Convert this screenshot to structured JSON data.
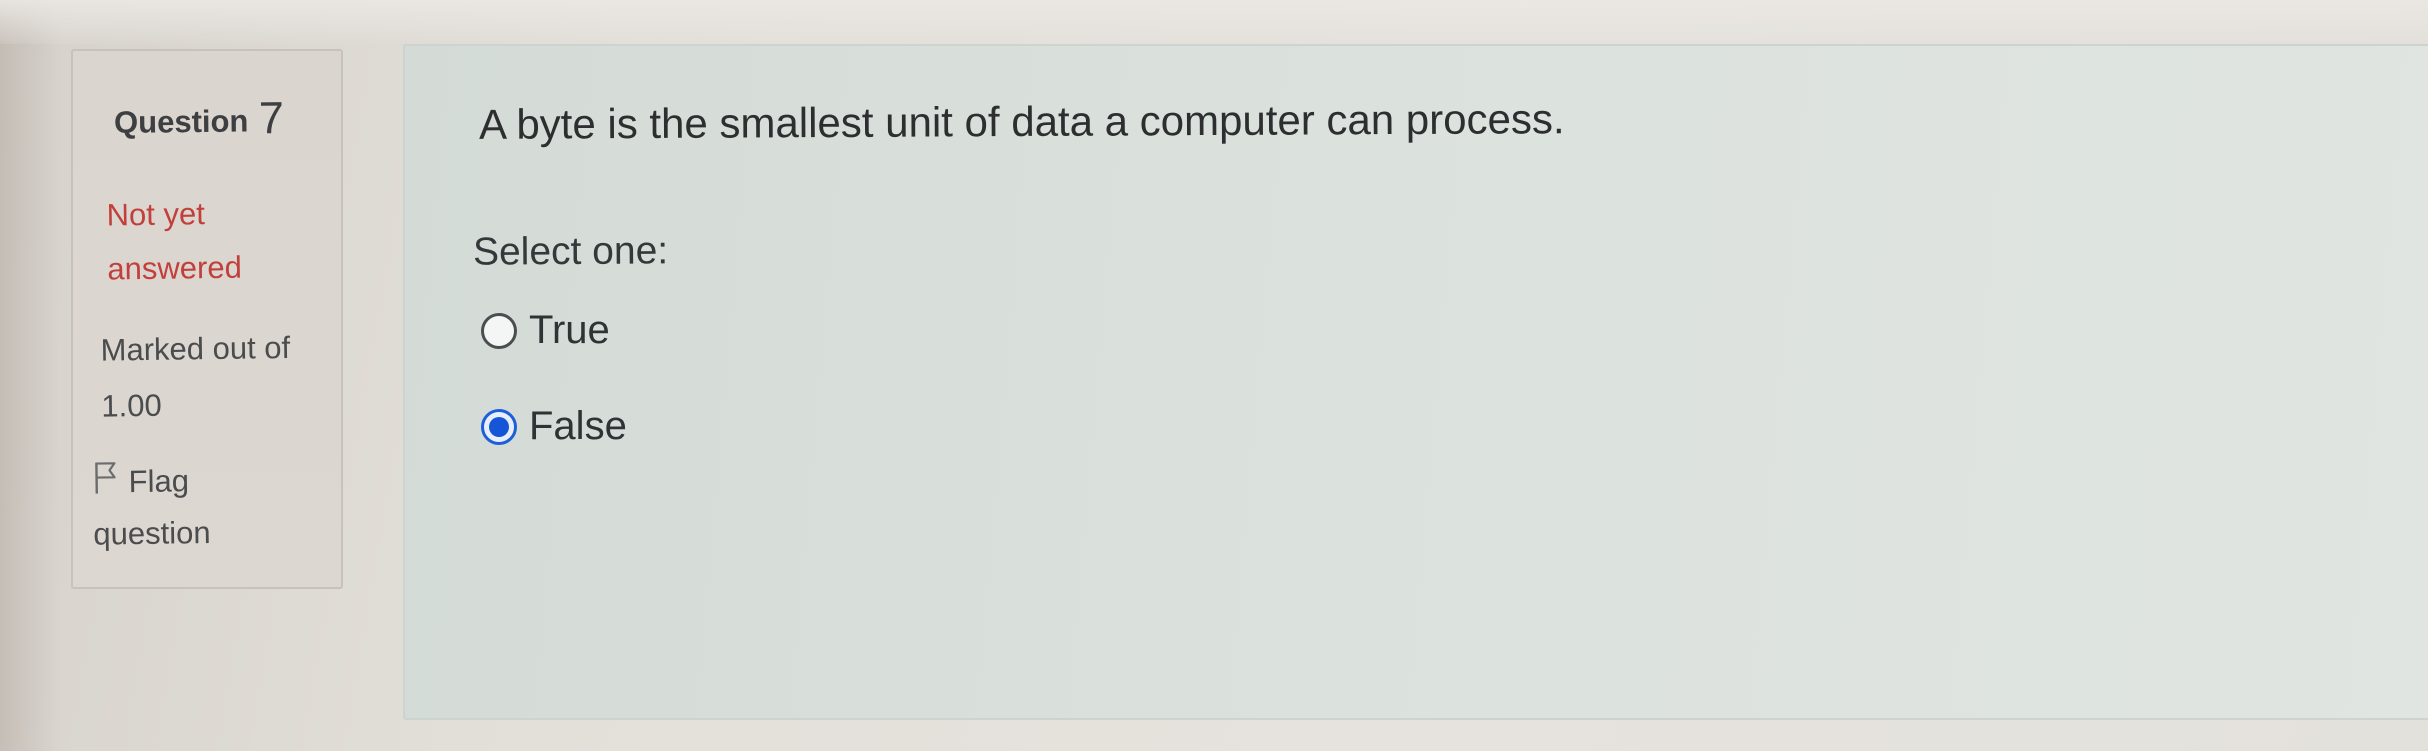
{
  "question_info": {
    "label": "Question",
    "number": "7",
    "state_line1": "Not yet",
    "state_line2": "answered",
    "grade_line1": "Marked out of",
    "grade_line2": "1.00",
    "flag_line1": "Flag",
    "flag_line2": "question",
    "flag_icon": "flag-outline-icon"
  },
  "question": {
    "text": "A byte is the smallest unit of data a computer can process.",
    "prompt": "Select one:",
    "options": [
      {
        "label": "True",
        "checked": false
      },
      {
        "label": "False",
        "checked": true
      }
    ]
  },
  "colors": {
    "state_text": "#c2403c",
    "radio_selected": "#1556d6"
  }
}
